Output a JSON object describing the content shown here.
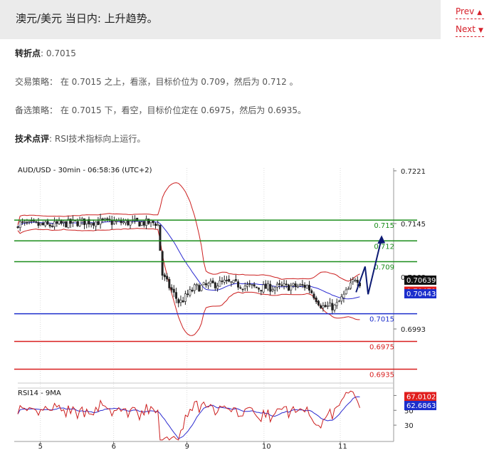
{
  "header": {
    "title": "澳元/美元 当日内: 上升趋势。",
    "prev_label": "Prev",
    "next_label": "Next"
  },
  "analysis": {
    "pivot_label": "转折点",
    "pivot_value": ": 0.7015",
    "strategy_label": "交易策略",
    "strategy_text": "： 在 0.7015 之上，看涨，目标价位为 0.709，然后为 0.712 。",
    "alternative_label": "备选策略",
    "alternative_text": "： 在 0.7015 下，看空，目标价位定在 0.6975，然后为 0.6935。",
    "comment_label": "技术点评",
    "comment_text": ": RSI技术指标向上运行。"
  },
  "colors": {
    "resistance": "#1a8c1a",
    "support_pivot": "#1c2ecc",
    "support": "#d81e1e",
    "candles": "#222222",
    "bollinger": "#cc1f1f",
    "moving_average": "#2b2bd0",
    "forecast_arrow": "#0c1a73",
    "rsi_line": "#cc1f1f",
    "rsi_ma": "#2b2bd0"
  },
  "chart_data": {
    "type": "candlestick",
    "title": "AUD/USD - 30min - 06:58:36 (UTC+2)",
    "x_tick_labels": [
      "5",
      "6",
      "9",
      "10",
      "11"
    ],
    "y_tick_labels": [
      "0.7221",
      "0.7145",
      "0.6993"
    ],
    "ylim": [
      0.6915,
      0.7225
    ],
    "levels": [
      {
        "value": 0.715,
        "label": "0.715",
        "kind": "resistance"
      },
      {
        "value": 0.712,
        "label": "0.712",
        "kind": "resistance"
      },
      {
        "value": 0.709,
        "label": "0.709",
        "kind": "resistance"
      },
      {
        "value": 0.7015,
        "label": "0.7015",
        "kind": "pivot"
      },
      {
        "value": 0.6975,
        "label": "0.6975",
        "kind": "support"
      },
      {
        "value": 0.6935,
        "label": "0.6935",
        "kind": "support"
      }
    ],
    "price_badges": [
      {
        "label": "0.70639",
        "value": 0.70639,
        "kind": "last"
      },
      {
        "label": "0.70479",
        "value": 0.70479,
        "kind": "band"
      },
      {
        "label": "0.70443",
        "value": 0.70443,
        "kind": "ma"
      }
    ],
    "partial_label": "0.7068",
    "forecast_path": [
      [
        0.9,
        0.7046
      ],
      [
        0.924,
        0.7083
      ],
      [
        0.932,
        0.7043
      ],
      [
        0.968,
        0.7124
      ]
    ],
    "rsi": {
      "title": "RSI14 - 9MA",
      "y_tick_labels": [
        "70",
        "50",
        "30"
      ],
      "ylim": [
        8,
        80
      ],
      "badges": [
        {
          "label": "67.0102",
          "value": 67.0102,
          "kind": "rsi"
        },
        {
          "label": "62.6863",
          "value": 62.6863,
          "kind": "ma"
        }
      ]
    }
  }
}
